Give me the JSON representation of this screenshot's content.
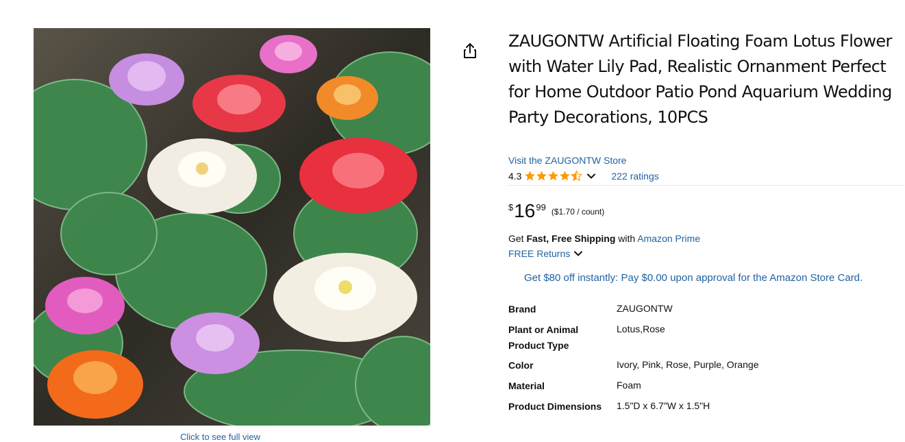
{
  "product": {
    "title": "ZAUGONTW Artificial Floating Foam Lotus Flower with Water Lily Pad, Realistic Ornanment Perfect for Home Outdoor Patio Pond Aquarium Wedding Party Decorations, 10PCS",
    "store_link": "Visit the ZAUGONTW Store",
    "rating": "4.3",
    "ratings_count": "222 ratings",
    "image_caption": "Click to see full view"
  },
  "price": {
    "symbol": "$",
    "whole": "16",
    "fraction": "99",
    "per_unit": "($1.70 / count)"
  },
  "shipping": {
    "prefix": "Get",
    "bold": "Fast, Free Shipping",
    "middle": "with",
    "link": "Amazon Prime",
    "returns": "FREE Returns"
  },
  "promo": "Get $80 off instantly: Pay $0.00 upon approval for the Amazon Store Card.",
  "specs": [
    {
      "key": "Brand",
      "value": "ZAUGONTW"
    },
    {
      "key": "Plant or Animal Product Type",
      "value": "Lotus,Rose"
    },
    {
      "key": "Color",
      "value": "Ivory, Pink, Rose, Purple, Orange"
    },
    {
      "key": "Material",
      "value": "Foam"
    },
    {
      "key": "Product Dimensions",
      "value": "1.5\"D x 6.7\"W x 1.5\"H"
    }
  ],
  "colors": {
    "link": "#2162a1",
    "star": "#ff9900",
    "text": "#0f1111"
  },
  "icons": [
    "share-icon",
    "star-icon",
    "chevron-down-icon"
  ]
}
